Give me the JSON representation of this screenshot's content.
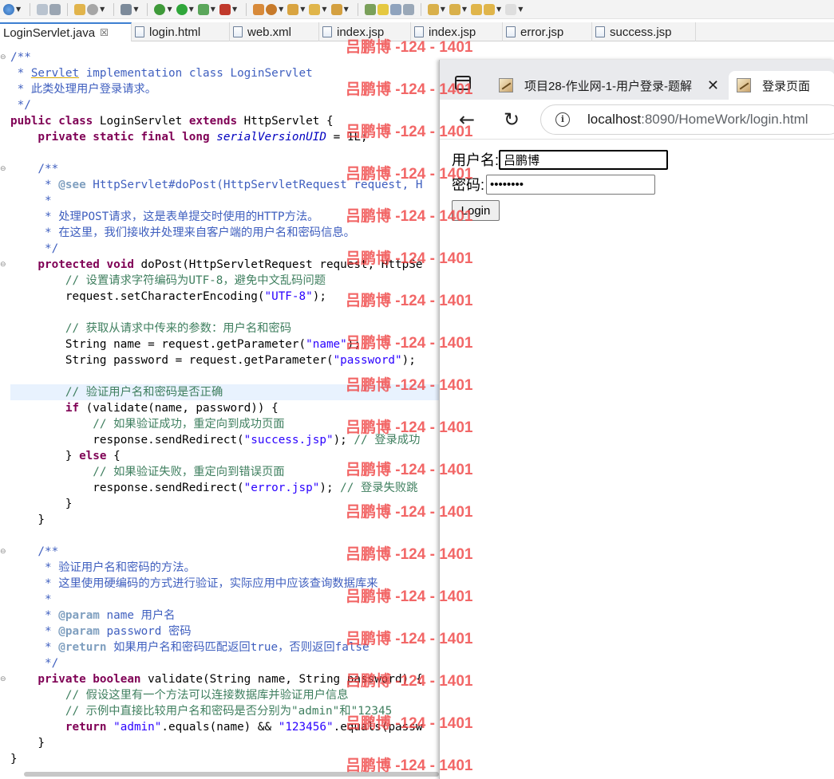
{
  "toolbar": {
    "icons": [
      "globe-icon",
      "open-folder-icon",
      "print-icon",
      "new-wizard-icon",
      "publish-icon",
      "open-type-icon",
      "debug-icon",
      "run-icon",
      "run-config-icon",
      "external-tools-icon",
      "new-java-project-icon",
      "new-package-icon",
      "open-task-icon",
      "search-icon",
      "mark-occurrences-icon",
      "toggle-breadcrumb-icon",
      "show-whitespace-icon",
      "next-annotation-icon",
      "prev-annotation-icon",
      "last-edit-icon",
      "back-icon",
      "forward-icon"
    ]
  },
  "editor_tabs": [
    {
      "label": "LoginServlet.java",
      "active": true
    },
    {
      "label": "login.html"
    },
    {
      "label": "web.xml"
    },
    {
      "label": "index.jsp"
    },
    {
      "label": "index.jsp"
    },
    {
      "label": "error.jsp"
    },
    {
      "label": "success.jsp"
    }
  ],
  "code": {
    "l1": "/**",
    "l2a": " * ",
    "l2b": "Servlet",
    "l2c": " implementation class LoginServlet",
    "l3": " * 此类处理用户登录请求。",
    "l4": " */",
    "l5a": "public class",
    "l5b": " LoginServlet ",
    "l5c": "extends",
    "l5d": " HttpServlet {",
    "l6a": "    private static final long",
    "l6b": " ",
    "l6c": "serialVersionUID",
    "l6d": " = 1L;",
    "l8": "    /**",
    "l9a": "     * ",
    "l9b": "@see",
    "l9c": " HttpServlet#doPost(HttpServletRequest request, H",
    "l10": "     *",
    "l11": "     * 处理POST请求，这是表单提交时使用的HTTP方法。",
    "l12": "     * 在这里，我们接收并处理来自客户端的用户名和密码信息。",
    "l13": "     */",
    "l14a": "    protected void",
    "l14b": " doPost(HttpServletRequest request, HttpSe",
    "l15": "        // 设置请求字符编码为UTF-8，避免中文乱码问题",
    "l16a": "        request.setCharacterEncoding(",
    "l16b": "\"UTF-8\"",
    "l16c": ");",
    "l18": "        // 获取从请求中传来的参数：用户名和密码",
    "l19a": "        String name = request.getParameter(",
    "l19b": "\"name\"",
    "l19c": ");",
    "l20a": "        String password = request.getParameter(",
    "l20b": "\"password\"",
    "l20c": ");",
    "l22": "        // 验证用户名和密码是否正确",
    "l23a": "        if",
    "l23b": " (validate(name, password)) {",
    "l24": "            // 如果验证成功，重定向到成功页面",
    "l25a": "            response.sendRedirect(",
    "l25b": "\"success.jsp\"",
    "l25c": "); ",
    "l25d": "// 登录成功",
    "l26a": "        } ",
    "l26b": "else",
    "l26c": " {",
    "l27": "            // 如果验证失败，重定向到错误页面",
    "l28a": "            response.sendRedirect(",
    "l28b": "\"error.jsp\"",
    "l28c": "); ",
    "l28d": "// 登录失败跳",
    "l29": "        }",
    "l30": "    }",
    "l32": "    /**",
    "l33": "     * 验证用户名和密码的方法。",
    "l34": "     * 这里使用硬编码的方式进行验证，实际应用中应该查询数据库来",
    "l35": "     *",
    "l36a": "     * ",
    "l36b": "@param",
    "l36c": " name 用户名",
    "l37a": "     * ",
    "l37b": "@param",
    "l37c": " password 密码",
    "l38a": "     * ",
    "l38b": "@return",
    "l38c": " 如果用户名和密码匹配返回true，否则返回false",
    "l39": "     */",
    "l40a": "    private boolean",
    "l40b": " validate(String name, String password) {",
    "l41": "        // 假设这里有一个方法可以连接数据库并验证用户信息",
    "l42": "        // 示例中直接比较用户名和密码是否分别为\"admin\"和\"12345",
    "l43a": "        return",
    "l43b": " ",
    "l43c": "\"admin\"",
    "l43d": ".equals(name) && ",
    "l43e": "\"123456\"",
    "l43f": ".equals(passw",
    "l44": "    }",
    "l45": "}"
  },
  "browser": {
    "tabs": [
      {
        "title": "项目28-作业网-1-用户登录-题解"
      },
      {
        "title": "登录页面",
        "active": true
      }
    ],
    "url_host": "localhost",
    "url_rest": ":8090/HomeWork/login.html",
    "form": {
      "username_label": "用户名:",
      "username_value": "吕鹏博",
      "password_label": "密码:",
      "password_value": "••••••••",
      "login_button": "Login"
    }
  },
  "watermark": {
    "text": "吕鹏博 -124 - 1401",
    "color": "#ef4646"
  }
}
